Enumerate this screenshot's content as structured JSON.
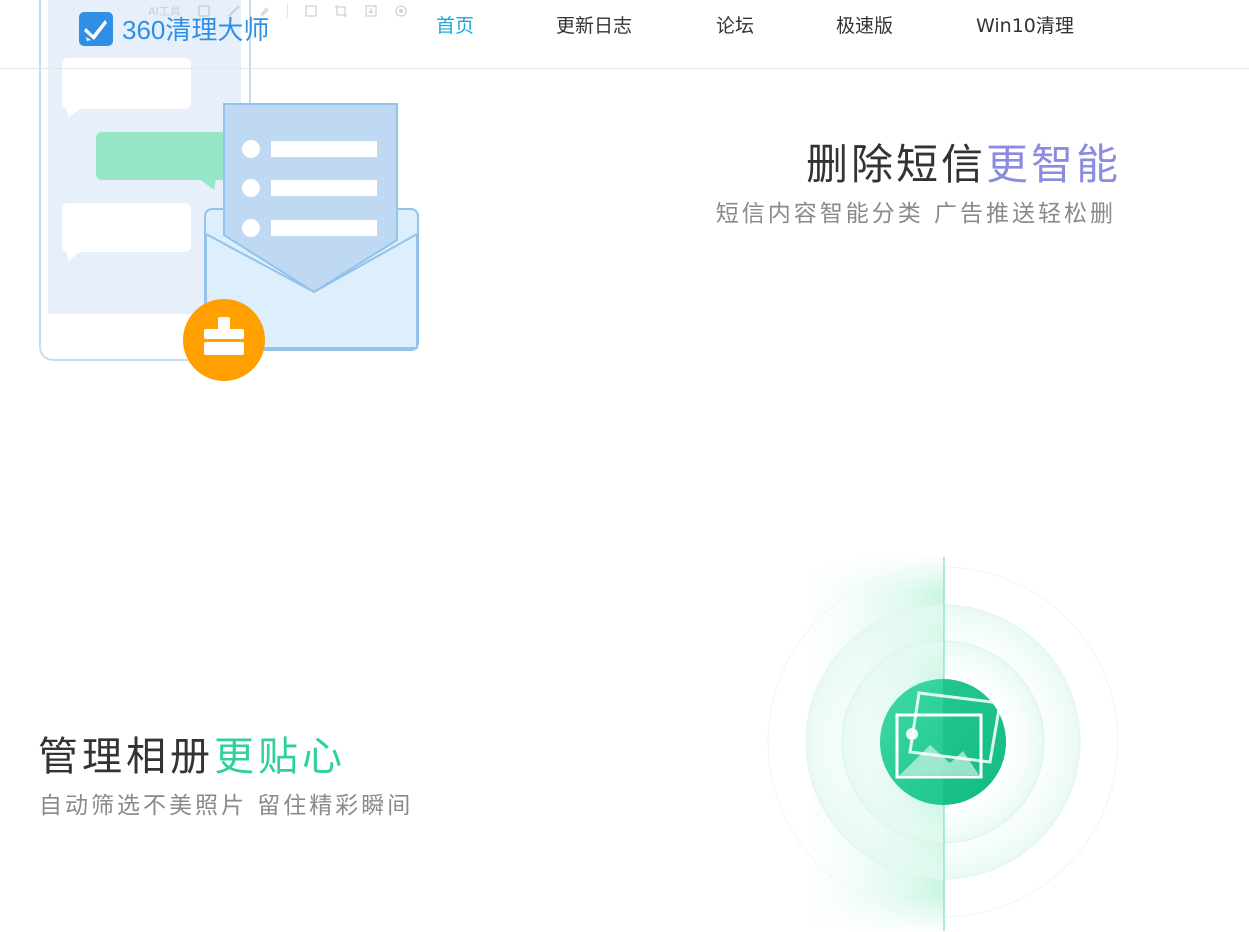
{
  "header": {
    "logo_text": "360清理大师",
    "ghost_toolbar_label": "AI工具",
    "nav": [
      {
        "label": "首页",
        "active": true
      },
      {
        "label": "更新日志",
        "active": false
      },
      {
        "label": "论坛",
        "active": false
      },
      {
        "label": "极速版",
        "active": false
      },
      {
        "label": "Win10清理",
        "active": false
      }
    ]
  },
  "sms_section": {
    "headline_main": "删除短信",
    "headline_accent": "更智能",
    "subtitle": "短信内容智能分类  广告推送轻松删"
  },
  "album_section": {
    "headline_main": "管理相册",
    "headline_accent": "更贴心",
    "subtitle": "自动筛选不美照片  留住精彩瞬间"
  },
  "colors": {
    "brand_blue": "#2f8fe6",
    "nav_active": "#18a7e0",
    "sms_accent": "#8b8ce0",
    "album_accent": "#2fd199",
    "broom_orange": "#ff9f00",
    "album_green": "#20c98f"
  },
  "icons": {
    "logo": "broom-logo-icon",
    "broom_badge": "broom-icon",
    "photo": "photo-icon"
  }
}
